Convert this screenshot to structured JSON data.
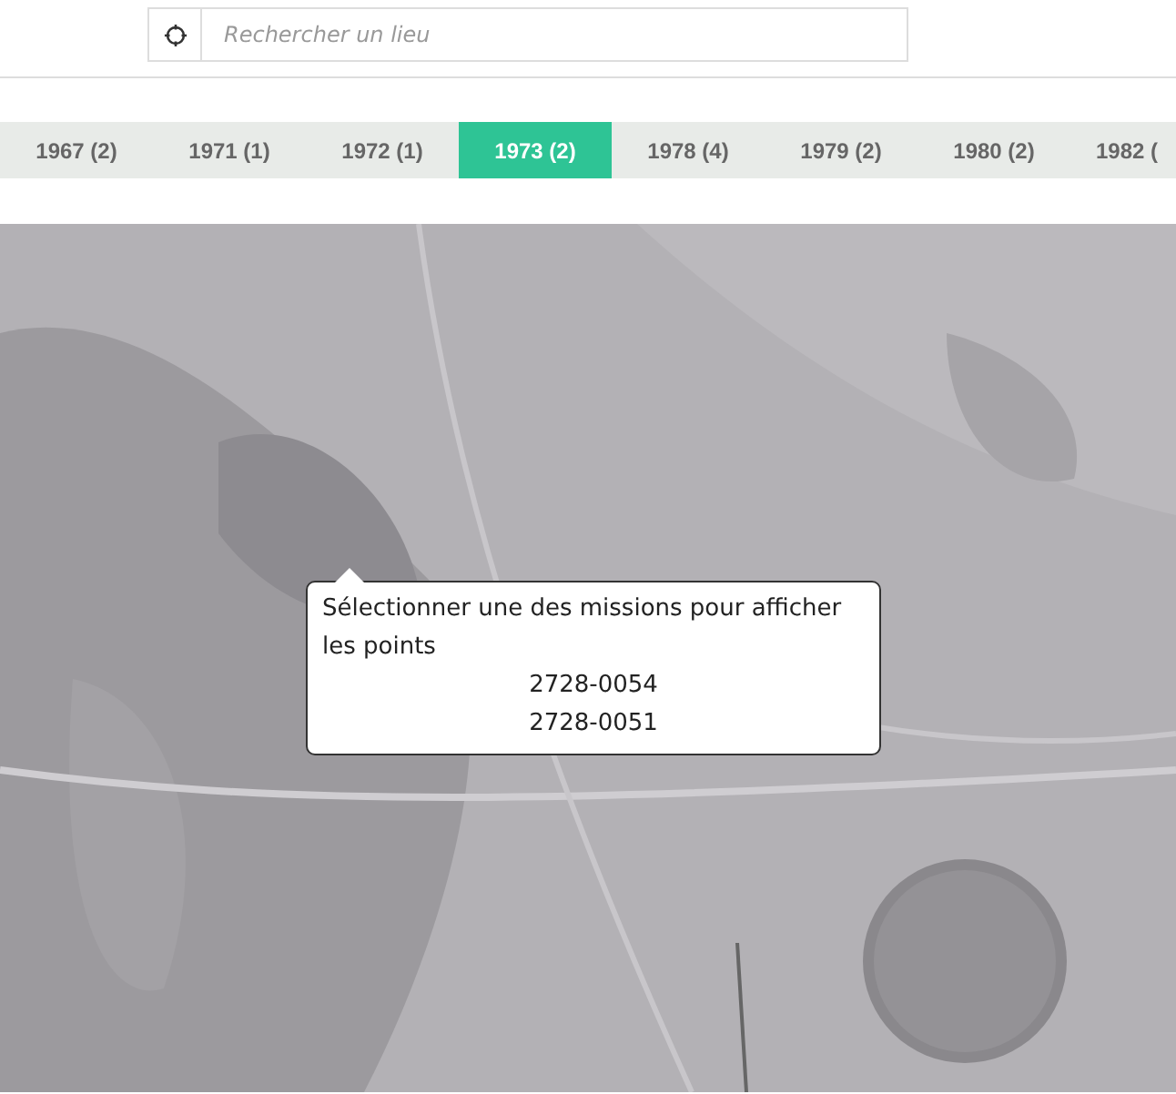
{
  "search": {
    "placeholder": "Rechercher un lieu"
  },
  "tabs": [
    {
      "label": "1967 (2)",
      "selected": false
    },
    {
      "label": "1971 (1)",
      "selected": false
    },
    {
      "label": "1972 (1)",
      "selected": false
    },
    {
      "label": "1973 (2)",
      "selected": true
    },
    {
      "label": "1978 (4)",
      "selected": false
    },
    {
      "label": "1979 (2)",
      "selected": false
    },
    {
      "label": "1980 (2)",
      "selected": false
    },
    {
      "label": "1982 (",
      "selected": false
    }
  ],
  "popup": {
    "message": "Sélectionner une des missions pour afficher les points",
    "missions": [
      "2728-0054",
      "2728-0051"
    ]
  }
}
